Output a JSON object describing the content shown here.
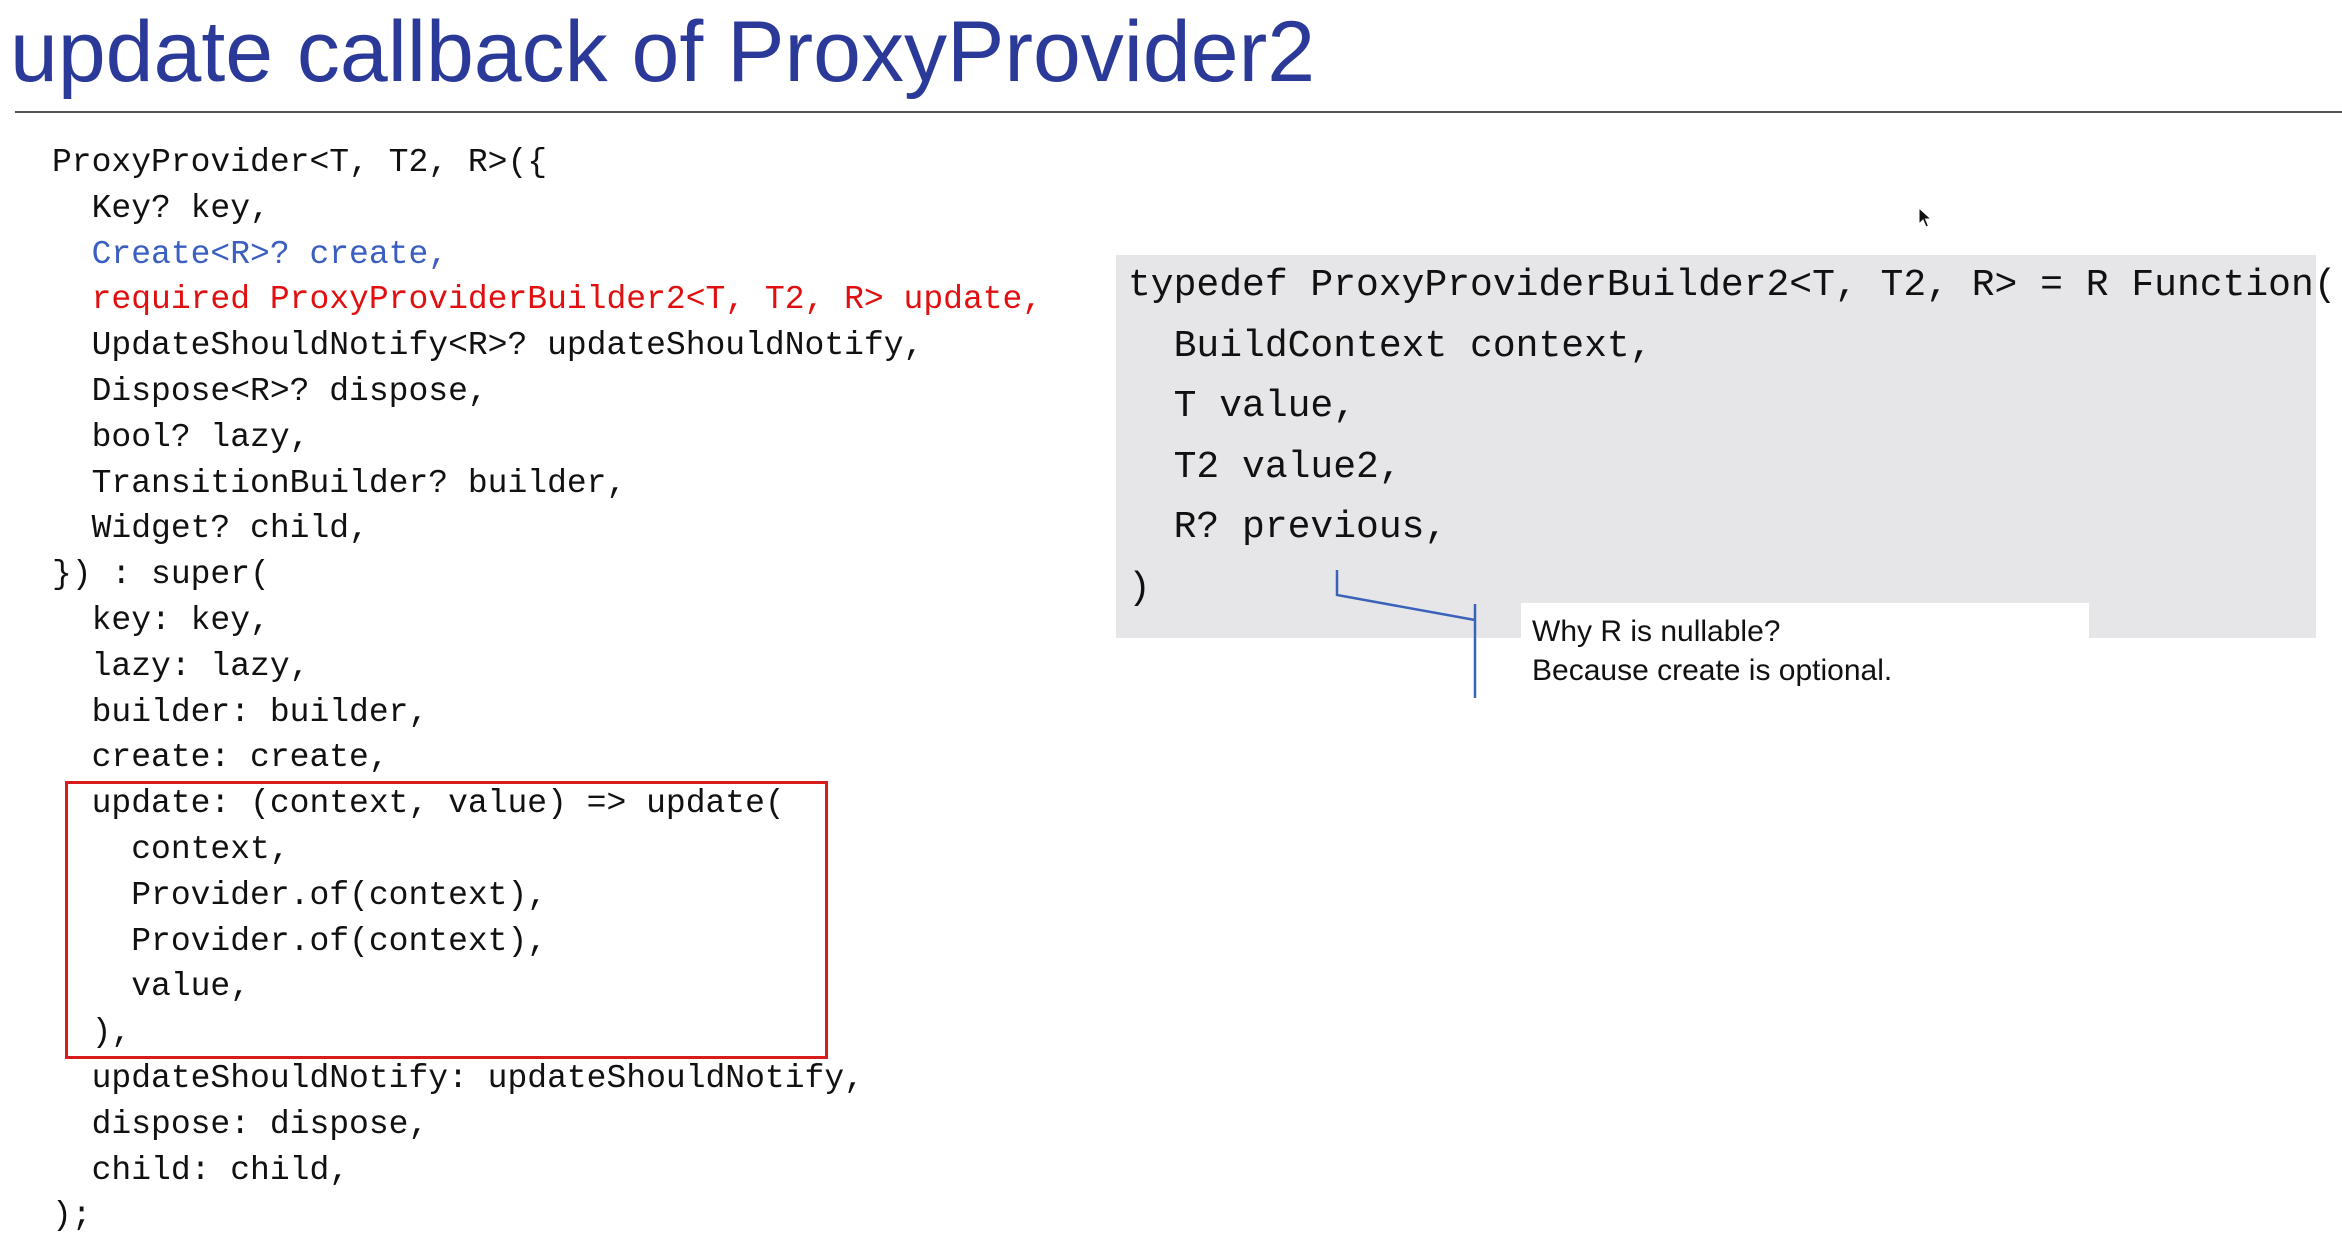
{
  "title": "update callback of ProxyProvider2",
  "left_code": [
    {
      "text": "ProxyProvider<T, T2, R>({",
      "color": "default"
    },
    {
      "text": "  Key? key,",
      "color": "default"
    },
    {
      "text": "  Create<R>? create,",
      "color": "blue"
    },
    {
      "text": "  required ProxyProviderBuilder2<T, T2, R> update,",
      "color": "red"
    },
    {
      "text": "  UpdateShouldNotify<R>? updateShouldNotify,",
      "color": "default"
    },
    {
      "text": "  Dispose<R>? dispose,",
      "color": "default"
    },
    {
      "text": "  bool? lazy,",
      "color": "default"
    },
    {
      "text": "  TransitionBuilder? builder,",
      "color": "default"
    },
    {
      "text": "  Widget? child,",
      "color": "default"
    },
    {
      "text": "}) : super(",
      "color": "default"
    },
    {
      "text": "  key: key,",
      "color": "default"
    },
    {
      "text": "  lazy: lazy,",
      "color": "default"
    },
    {
      "text": "  builder: builder,",
      "color": "default"
    },
    {
      "text": "  create: create,",
      "color": "default"
    },
    {
      "text": "  update: (context, value) => update(",
      "color": "default"
    },
    {
      "text": "    context,",
      "color": "default"
    },
    {
      "text": "    Provider.of(context),",
      "color": "default"
    },
    {
      "text": "    Provider.of(context),",
      "color": "default"
    },
    {
      "text": "    value,",
      "color": "default"
    },
    {
      "text": "  ),",
      "color": "default"
    },
    {
      "text": "  updateShouldNotify: updateShouldNotify,",
      "color": "default"
    },
    {
      "text": "  dispose: dispose,",
      "color": "default"
    },
    {
      "text": "  child: child,",
      "color": "default"
    },
    {
      "text": ");",
      "color": "default"
    }
  ],
  "typedef_code": [
    "typedef ProxyProviderBuilder2<T, T2, R> = R Function(",
    "  BuildContext context,",
    "  T value,",
    "  T2 value2,",
    "  R? previous,",
    ")"
  ],
  "annotation": {
    "line1": "Why R is nullable?",
    "line2": "Because create is optional."
  },
  "colors": {
    "title": "#2b3a98",
    "code_default": "#111111",
    "code_blue": "#3b5fc0",
    "code_red": "#e01010",
    "highlight_border": "#d81b1b",
    "panel_background": "#e6e6e8",
    "callout_line": "#3a62b8"
  }
}
